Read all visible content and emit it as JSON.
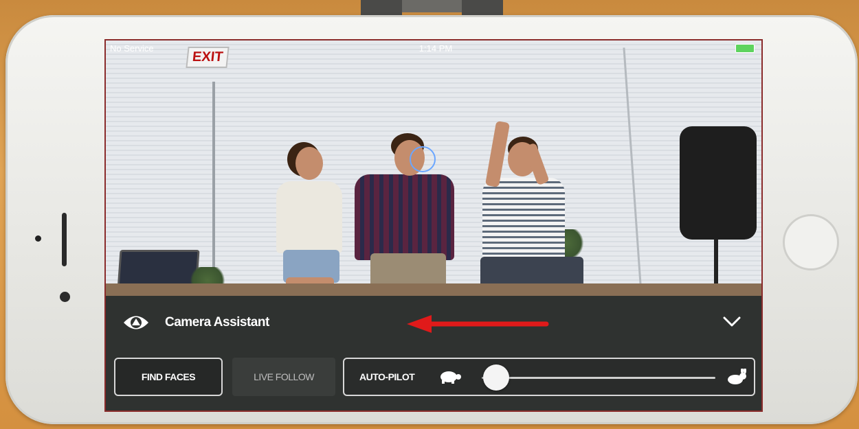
{
  "status_bar": {
    "carrier": "No Service",
    "time": "1:14 PM"
  },
  "scene": {
    "exit_sign": "EXIT"
  },
  "panel": {
    "title": "Camera Assistant",
    "icon": "eye-icon",
    "collapse_icon": "chevron-down-icon",
    "buttons": {
      "find_faces": "FIND FACES",
      "live_follow": "LIVE FOLLOW"
    },
    "autopilot": {
      "label": "AUTO-PILOT",
      "slow_icon": "turtle-icon",
      "fast_icon": "rabbit-icon",
      "speed_level": 0.05
    }
  },
  "annotation": {
    "arrow_color": "#e01a1a",
    "arrow_direction": "left"
  },
  "colors": {
    "panel_bg": "#2f3230",
    "screen_border": "#8a2b2b"
  }
}
